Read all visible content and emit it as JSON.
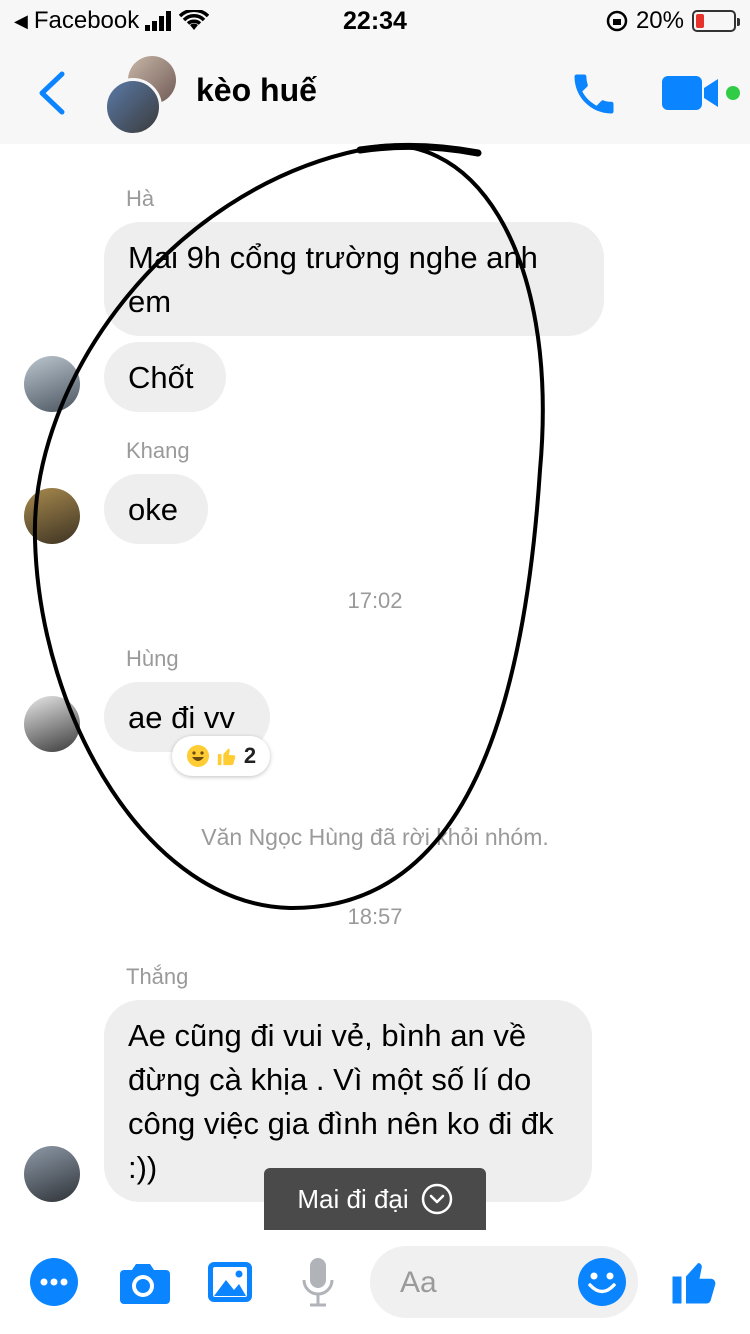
{
  "status": {
    "carrier": "Facebook",
    "time": "22:34",
    "battery": "20%"
  },
  "header": {
    "title": "kèo huế"
  },
  "messages": [
    {
      "sender": "Hà",
      "text": "Mai 9h cổng trường nghe anh em"
    },
    {
      "text": "Chốt"
    },
    {
      "sender": "Khang",
      "text": "oke"
    },
    {
      "timestamp": "17:02"
    },
    {
      "sender": "Hùng",
      "text": "ae đi vv",
      "reaction_count": "2"
    },
    {
      "system": "Văn Ngọc Hùng đã rời khỏi nhóm."
    },
    {
      "timestamp": "18:57"
    },
    {
      "sender": "Thắng",
      "text": "Ae cũng đi vui vẻ, bình an về đừng cà khịa . Vì một số lí do công việc gia đình nên ko đi đk :))"
    }
  ],
  "toast": {
    "label": "Mai đi đại"
  },
  "composer": {
    "placeholder": "Aa"
  },
  "colors": {
    "accent": "#0a84ff",
    "bubble": "#eeeeef",
    "meta": "#9a9a9a"
  }
}
